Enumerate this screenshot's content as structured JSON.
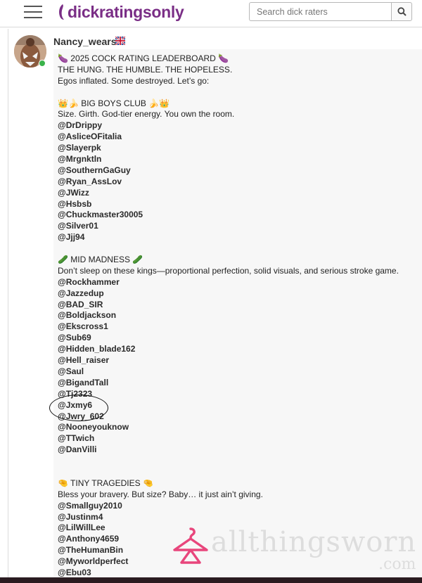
{
  "header": {
    "logo_text": "dickratingsonly",
    "search_placeholder": "Search dick raters"
  },
  "post": {
    "username": "Nancy_wears",
    "lines": [
      {
        "text": "🍆 2025 COCK RATING LEADERBOARD 🍆",
        "type": "text"
      },
      {
        "text": "THE HUNG. THE HUMBLE. THE HOPELESS.",
        "type": "text"
      },
      {
        "text": "Egos inflated. Some destroyed. Let’s go:",
        "type": "text"
      },
      {
        "text": "",
        "type": "blank"
      },
      {
        "text": "👑🍌 BIG BOYS CLUB 🍌👑",
        "type": "text"
      },
      {
        "text": "Size. Girth. God-tier energy. You own the room.",
        "type": "text"
      },
      {
        "text": "@DrDrippy",
        "type": "handle"
      },
      {
        "text": "@AsliceOFitalia",
        "type": "handle"
      },
      {
        "text": "@Slayerpk",
        "type": "handle"
      },
      {
        "text": "@Mrgnktln",
        "type": "handle"
      },
      {
        "text": "@SouthernGaGuy",
        "type": "handle"
      },
      {
        "text": "@Ryan_AssLov",
        "type": "handle"
      },
      {
        "text": "@JWizz",
        "type": "handle"
      },
      {
        "text": "@Hsbsb",
        "type": "handle"
      },
      {
        "text": "@Chuckmaster30005",
        "type": "handle"
      },
      {
        "text": "@Silver01",
        "type": "handle"
      },
      {
        "text": "@Jjj94",
        "type": "handle"
      },
      {
        "text": "",
        "type": "blank"
      },
      {
        "text": "🥒 MID MADNESS 🥒",
        "type": "text"
      },
      {
        "text": "Don’t sleep on these kings—proportional perfection, solid visuals, and serious stroke game.",
        "type": "text"
      },
      {
        "text": "@Rockhammer",
        "type": "handle"
      },
      {
        "text": "@Jazzedup",
        "type": "handle"
      },
      {
        "text": "@BAD_SIR",
        "type": "handle"
      },
      {
        "text": "@Boldjackson",
        "type": "handle"
      },
      {
        "text": "@Ekscross1",
        "type": "handle"
      },
      {
        "text": "@Sub69",
        "type": "handle"
      },
      {
        "text": "@Hidden_blade162",
        "type": "handle"
      },
      {
        "text": "@Hell_raiser",
        "type": "handle"
      },
      {
        "text": "@Saul",
        "type": "handle"
      },
      {
        "text": "@BigandTall",
        "type": "handle"
      },
      {
        "text": "@Tj2323",
        "type": "handle"
      },
      {
        "text": "@Jxmy6",
        "type": "handle"
      },
      {
        "text": "@Jwry_602",
        "type": "handle"
      },
      {
        "text": "@Nooneyouknow",
        "type": "handle"
      },
      {
        "text": "@TTwich",
        "type": "handle"
      },
      {
        "text": "@DanVilli",
        "type": "handle"
      },
      {
        "text": "",
        "type": "blank2"
      },
      {
        "text": "🤏 TINY TRAGEDIES 🤏",
        "type": "text"
      },
      {
        "text": "Bless your bravery. But size? Baby… it just ain’t giving.",
        "type": "text"
      },
      {
        "text": "@Smallguy2010",
        "type": "handle"
      },
      {
        "text": "@Justinm4",
        "type": "handle"
      },
      {
        "text": "@LilWillLee",
        "type": "handle"
      },
      {
        "text": "@Anthony4659",
        "type": "handle"
      },
      {
        "text": "@TheHumanBin",
        "type": "handle"
      },
      {
        "text": "@Myworldperfect",
        "type": "handle"
      },
      {
        "text": "@Ebu03",
        "type": "handle"
      }
    ]
  },
  "watermark": {
    "text": "allthingsworn",
    "sub": ".com"
  },
  "colors": {
    "brand": "#7a2e86",
    "online": "#3ab34a",
    "watermark_hanger": "#e8467c"
  }
}
